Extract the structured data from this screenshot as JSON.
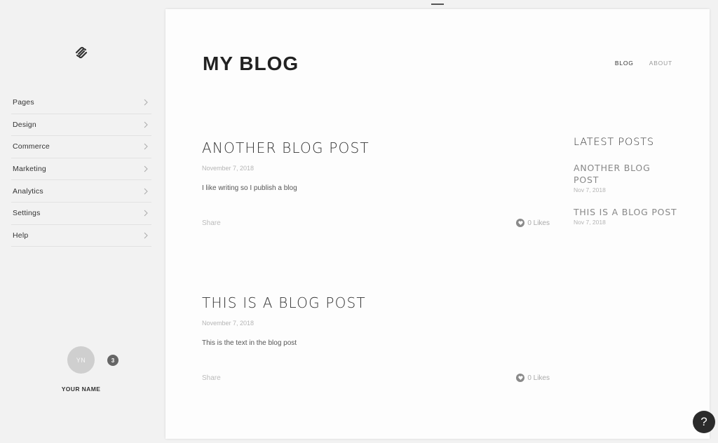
{
  "sidebar": {
    "logo_icon": "squarespace-logo-icon",
    "items": [
      {
        "label": "Pages"
      },
      {
        "label": "Design"
      },
      {
        "label": "Commerce"
      },
      {
        "label": "Marketing"
      },
      {
        "label": "Analytics"
      },
      {
        "label": "Settings"
      },
      {
        "label": "Help"
      }
    ],
    "user": {
      "initials": "YN",
      "notification_count": "3",
      "name": "YOUR NAME"
    }
  },
  "site": {
    "title": "MY BLOG",
    "nav": [
      {
        "label": "BLOG",
        "active": true
      },
      {
        "label": "ABOUT",
        "active": false
      }
    ]
  },
  "posts": [
    {
      "title": "ANOTHER BLOG POST",
      "date": "November 7, 2018",
      "body": "I like writing so I publish a blog",
      "share_label": "Share",
      "likes_label": "0 Likes"
    },
    {
      "title": "THIS IS A BLOG POST",
      "date": "November 7, 2018",
      "body": "This is the text in the blog post",
      "share_label": "Share",
      "likes_label": "0 Likes"
    }
  ],
  "latest_posts": {
    "title": "LATEST POSTS",
    "items": [
      {
        "title": "ANOTHER BLOG POST",
        "date": "Nov 7, 2018"
      },
      {
        "title": "THIS IS A BLOG POST",
        "date": "Nov 7, 2018"
      }
    ]
  },
  "help": {
    "label": "?"
  }
}
